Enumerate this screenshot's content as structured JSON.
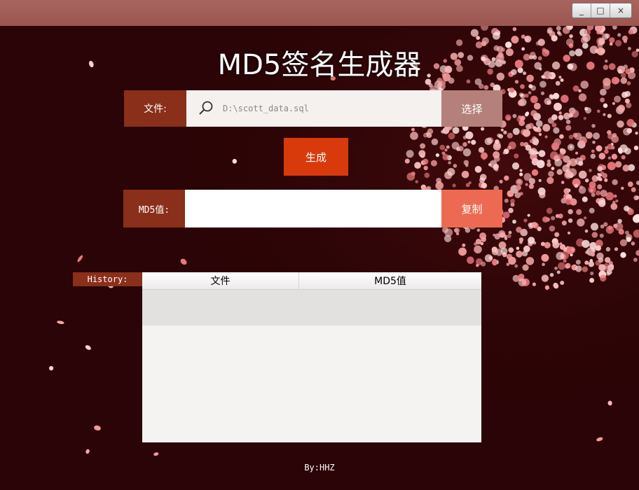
{
  "window": {
    "controls": {
      "minimize": "_",
      "maximize": "□",
      "close": "×"
    }
  },
  "app": {
    "title": "MD5签名生成器",
    "footer": "By:HHZ"
  },
  "file": {
    "label": "文件:",
    "value": "D:\\scott_data.sql",
    "icon": "search-icon",
    "choose_label": "选择"
  },
  "generate_label": "生成",
  "md5": {
    "label": "MD5值:",
    "value": "",
    "copy_label": "复制"
  },
  "history": {
    "label": "History:",
    "columns": [
      "文件",
      "MD5值"
    ],
    "rows": [
      {
        "file": "",
        "md5": ""
      }
    ]
  },
  "colors": {
    "background": "#2a0406",
    "label_bg": "#8a2f1a",
    "generate_bg": "#d93a0c",
    "choose_bg": "#b5807a",
    "copy_bg": "#ec6a51",
    "blossom": "#f2a3a5"
  }
}
